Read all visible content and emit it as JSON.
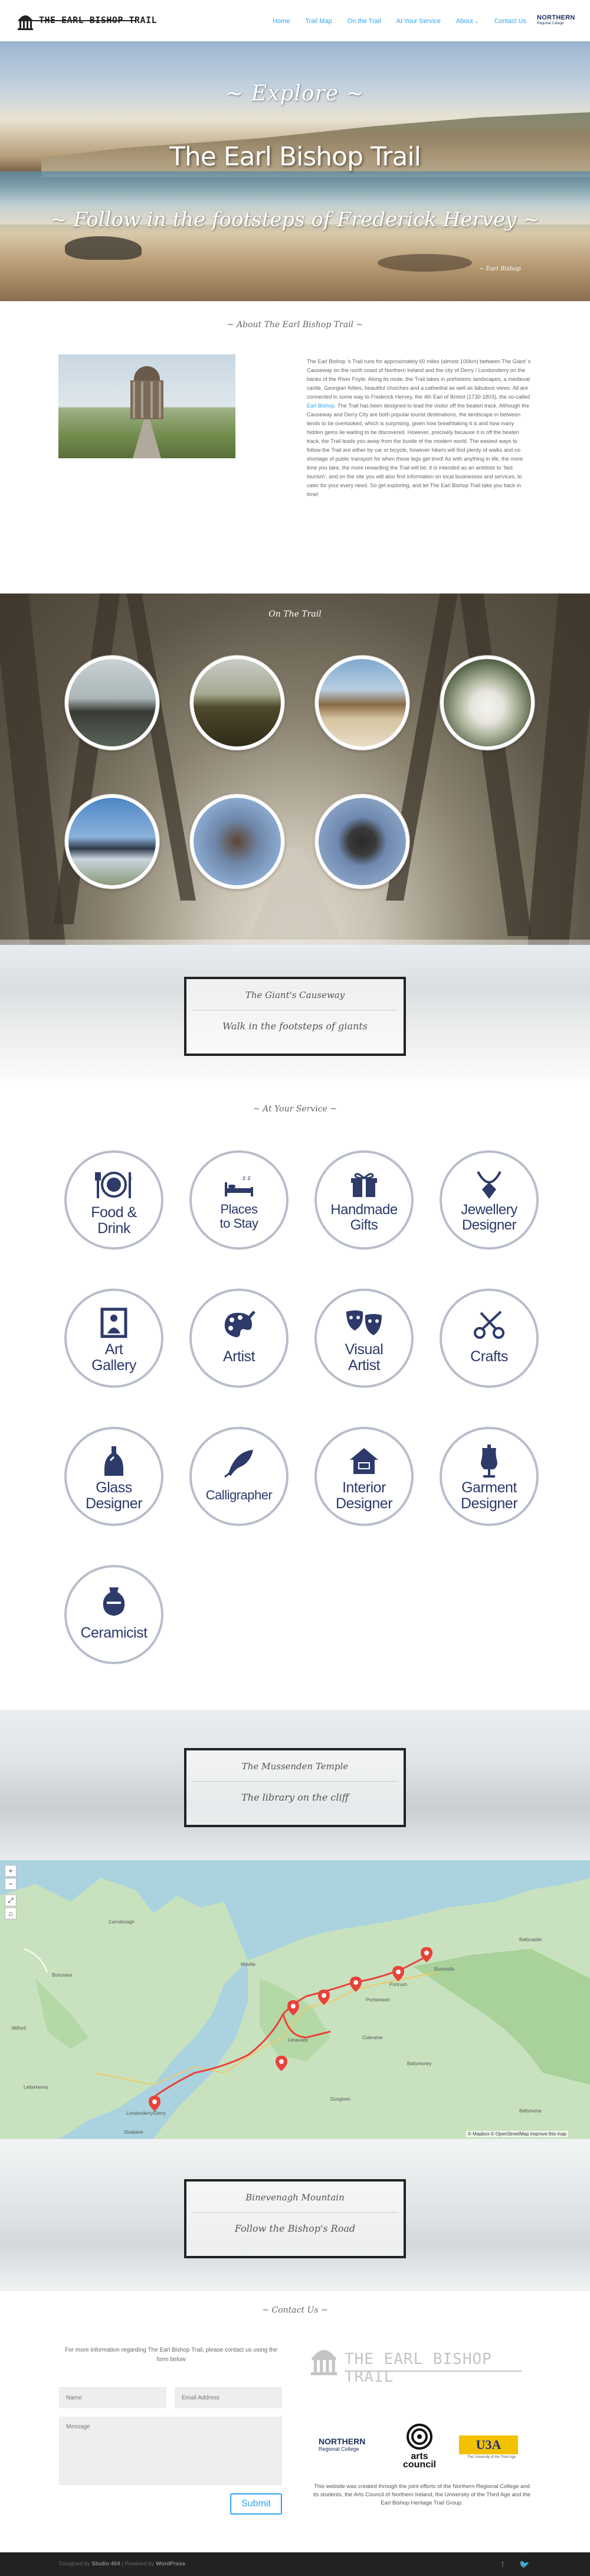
{
  "header": {
    "logo_text": "THE EARL BISHOP TRAIL",
    "nav": [
      {
        "label": "Home"
      },
      {
        "label": "Trail Map"
      },
      {
        "label": "On the Trail"
      },
      {
        "label": "At Your Service"
      },
      {
        "label": "About"
      },
      {
        "label": "Contact Us"
      }
    ],
    "partner_logo": {
      "name": "NORTHERN",
      "sub": "Regional College"
    },
    "accent_color": "#2ea3f2"
  },
  "hero": {
    "eyebrow": "~ Explore ~",
    "title": "The Earl Bishop Trail",
    "subtitle": "~ Follow in the footsteps of Frederick Hervey ~",
    "signature": "~ Earl Bishop"
  },
  "about": {
    "section_title": "~ About The Earl Bishop Trail ~",
    "text_before_link": "The Earl Bishop ‘s Trail runs for approximately 60 miles (almost 100km) between The Giant’ s Causeway on the north coast of Northern Ireland and the city of Derry / Londonderry on the banks of the River Foyle. Along its route, the Trail takes in prehistoric landscapes, a medieval castle, Georgian follies, beautiful churches and a cathedral as well as fabulous views. All are connected in some way to Frederick Hervey, the 4th Earl of Bristol (1730-1803), the so-called ",
    "link_text": "Earl Bishop",
    "text_after_link": ". The Trail has been designed to lead the visitor off the beaten track. Although the Causeway and Derry City are both popular tourist destinations, the landscape in between tends to be overlooked, which is surprising, given how breathtaking it is and how many hidden gems lie waiting to be discovered. However, precisely because it is off the beaten track, the Trail leads you away from the bustle of the modern world. The easiest ways to follow the Trail are either by car or bicycle, however hikers will find plenty of walks and no shortage of public transport for when those legs get tired! As with anything in life, the more time you take, the more rewarding the Trail will be; it is intended as an antidote to ‘fast tourism’, and on the site you will also find information on local businesses and services, to cater for your every need. So get exploring, and let The Earl Bishop Trail take you back in time!"
  },
  "on_the_trail": {
    "section_title": "On The Trail",
    "places": [
      {
        "icon": "coast-rocks-photo"
      },
      {
        "icon": "castle-ruins-photo"
      },
      {
        "icon": "beach-cliffs-photo"
      },
      {
        "icon": "georgian-house-photo"
      },
      {
        "icon": "mountain-view-photo"
      },
      {
        "icon": "horse-statue-photo"
      },
      {
        "icon": "camera-photo"
      }
    ]
  },
  "band_causeway": {
    "title": "The Giant's Causeway",
    "tagline": "Walk in the footsteps of giants"
  },
  "services": {
    "section_title": "~ At Your Service ~",
    "items": [
      {
        "label1": "Food &",
        "label2": "Drink",
        "icon": "cutlery-icon"
      },
      {
        "label1": "Places",
        "label2": "to Stay",
        "icon": "bed-icon"
      },
      {
        "label1": "Handmade",
        "label2": "Gifts",
        "icon": "gift-icon"
      },
      {
        "label1": "Jewellery",
        "label2": "Designer",
        "icon": "jewellery-icon"
      },
      {
        "label1": "Art",
        "label2": "Gallery",
        "icon": "frame-icon"
      },
      {
        "label1": "Artist",
        "label2": "",
        "icon": "palette-icon"
      },
      {
        "label1": "Visual",
        "label2": "Artist",
        "icon": "masks-icon"
      },
      {
        "label1": "Crafts",
        "label2": "",
        "icon": "scissors-icon"
      },
      {
        "label1": "Glass",
        "label2": "Designer",
        "icon": "glass-bottle-icon"
      },
      {
        "label1": "Calligrapher",
        "label2": "",
        "icon": "quill-icon"
      },
      {
        "label1": "Interior",
        "label2": "Designer",
        "icon": "house-icon"
      },
      {
        "label1": "Garment",
        "label2": "Designer",
        "icon": "mannequin-icon"
      },
      {
        "label1": "Ceramicist",
        "label2": "",
        "icon": "vase-icon"
      }
    ],
    "icon_color": "#2d3a6a",
    "ring_color": "#b8bdcc"
  },
  "band_temple": {
    "title": "The Mussenden Temple",
    "tagline": "The library on the cliff"
  },
  "map": {
    "controls": [
      "+",
      "−",
      "⤢",
      "⌂"
    ],
    "attribution": "© Mapbox © OpenStreetMap Improve this map",
    "towns": [
      "Ballycastle",
      "Carndonagh",
      "Moville",
      "Buncrana",
      "Limavady",
      "Coleraine",
      "Portstewart",
      "Portrush",
      "Bushmills",
      "Ballymoney",
      "Ballymena",
      "Londonderry/Derry",
      "Strabane",
      "Dungiven",
      "Letterkenny",
      "Milford"
    ],
    "route_color": "#e8423a"
  },
  "band_binevenagh": {
    "title": "Binevenagh Mountain",
    "tagline": "Follow the Bishop's Road"
  },
  "contact": {
    "section_title": "~ Contact Us ~",
    "intro": "For more information regarding The Earl Bishop Trail, please contact us using the form below",
    "name_placeholder": "Name",
    "email_placeholder": "Email Address",
    "message_placeholder": "Message",
    "submit_label": "Submit",
    "logo_text": "THE EARL BISHOP TRAIL",
    "partners": [
      {
        "name": "NORTHERN",
        "sub": "Regional College"
      },
      {
        "name": "arts council",
        "sub": ""
      },
      {
        "name": "U3A",
        "sub": "The University of the Third Age"
      }
    ],
    "footer_text": "This website was created through the joint efforts of the Northern Regional College and its students, the Arts Council of Northern Ireland, the University of the Third Age and the Earl Bishop Heritage Trail Group."
  },
  "footer": {
    "designed_by": "Designed by",
    "designer": "Studio 404",
    "sep": "|",
    "powered_by": "Powered by",
    "platform": "WordPress",
    "social": [
      "facebook-icon",
      "twitter-icon"
    ]
  }
}
